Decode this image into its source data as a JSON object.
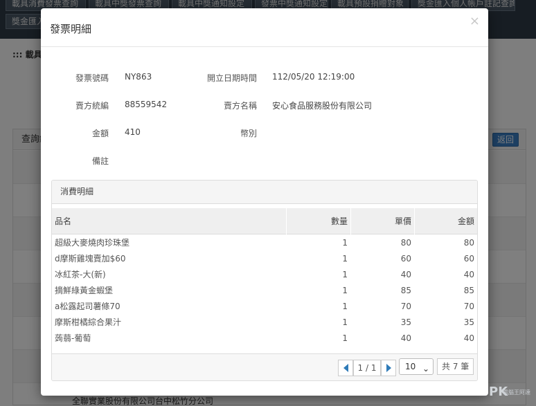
{
  "background": {
    "nav_buttons": [
      "載具消費發票查詢",
      "載具中獎發票查詢",
      "載具中獎通知設定",
      "發票中獎通知設定",
      "載具預設捐贈對象",
      "獎金匯入個人帳戶註記查詢",
      "獎金匯入"
    ],
    "section_title": "::: 載具",
    "panel_title": "查詢結",
    "back_label": "返回",
    "bottom_text": "全聯實業股份有限公司台中松竹分公司"
  },
  "modal": {
    "title": "發票明細",
    "close_label": "×",
    "info": {
      "invoice_no_label": "發票號碼",
      "invoice_no": "NY863",
      "issue_datetime_label": "開立日期時間",
      "issue_datetime": "112/05/20 12:19:00",
      "seller_id_label": "賣方統編",
      "seller_id": "88559542",
      "seller_name_label": "賣方名稱",
      "seller_name": "安心食品服務股份有限公司",
      "amount_label": "金額",
      "amount": "410",
      "currency_label": "幣別",
      "currency": "",
      "note_label": "備註",
      "note": ""
    },
    "detail": {
      "title": "消費明細",
      "columns": {
        "name": "品名",
        "qty": "數量",
        "unit_price": "單價",
        "amount": "金額"
      },
      "rows": [
        {
          "name": "超級大麥燒肉珍珠堡",
          "qty": "1",
          "unit_price": "80",
          "amount": "80"
        },
        {
          "name": "d摩斯雞塊賣加$60",
          "qty": "1",
          "unit_price": "60",
          "amount": "60"
        },
        {
          "name": "冰紅茶-大(新)",
          "qty": "1",
          "unit_price": "40",
          "amount": "40"
        },
        {
          "name": "摘鮮綠黃金蝦堡",
          "qty": "1",
          "unit_price": "85",
          "amount": "85"
        },
        {
          "name": "a松露起司薯條70",
          "qty": "1",
          "unit_price": "70",
          "amount": "70"
        },
        {
          "name": "摩斯柑橘綜合果汁",
          "qty": "1",
          "unit_price": "35",
          "amount": "35"
        },
        {
          "name": "蒟蒻-葡萄",
          "qty": "1",
          "unit_price": "40",
          "amount": "40"
        }
      ],
      "pager": {
        "page_info": "1 / 1",
        "page_size": "10",
        "total": "共 7 筆"
      }
    }
  },
  "watermark": {
    "text": "PK",
    "sub": "電腦王阿達"
  },
  "colors": {
    "accent": "#2f7bb8",
    "overlay": "rgba(0,0,0,0.5)"
  }
}
